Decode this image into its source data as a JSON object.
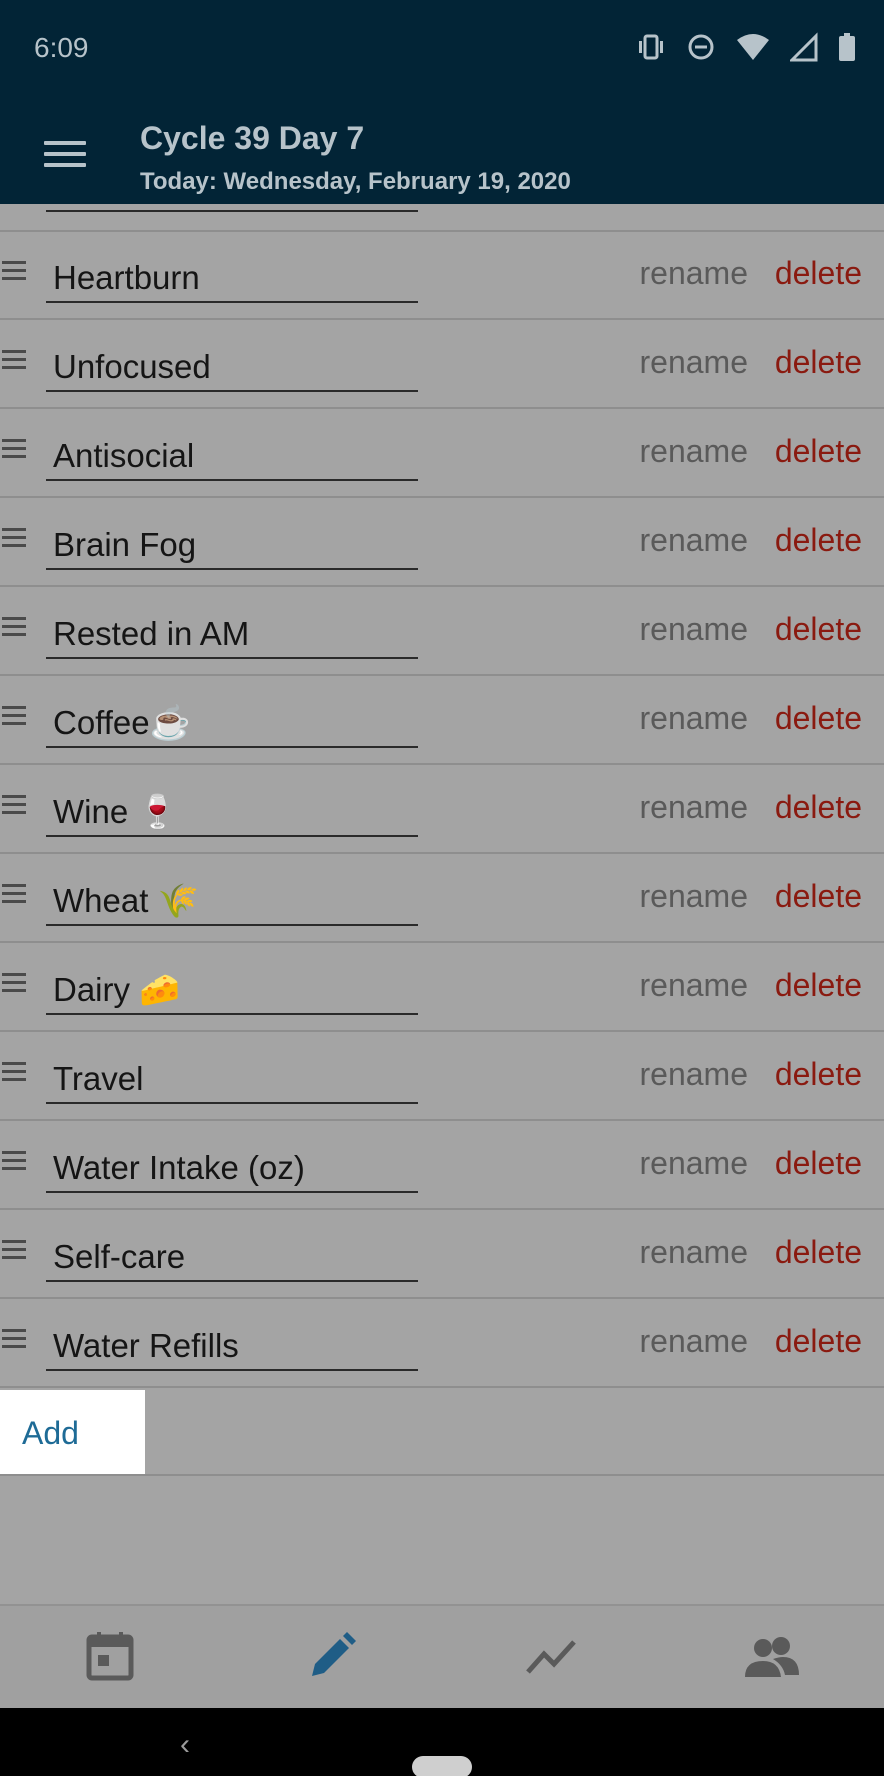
{
  "status_bar": {
    "time": "6:09",
    "icons": [
      "vibrate-icon",
      "do-not-disturb-icon",
      "wifi-icon",
      "signal-icon",
      "battery-icon"
    ]
  },
  "app_bar": {
    "title": "Cycle 39 Day 7",
    "subtitle": "Today: Wednesday, February 19, 2020",
    "menu_icon": "menu-icon"
  },
  "rows": [
    {
      "name": "Heartburn"
    },
    {
      "name": "Unfocused"
    },
    {
      "name": "Antisocial"
    },
    {
      "name": "Brain Fog"
    },
    {
      "name": "Rested in AM"
    },
    {
      "name": "Coffee☕"
    },
    {
      "name": "Wine 🍷"
    },
    {
      "name": "Wheat 🌾"
    },
    {
      "name": "Dairy 🧀"
    },
    {
      "name": "Travel"
    },
    {
      "name": "Water Intake (oz)"
    },
    {
      "name": "Self-care"
    },
    {
      "name": "Water Refills"
    }
  ],
  "row_actions": {
    "rename": "rename",
    "delete": "delete"
  },
  "add_label": "Add",
  "colors": {
    "header_bg": "#022436",
    "add_text": "#1e6b96",
    "delete_text": "#8a1a10",
    "active_tab": "#1f5d86"
  },
  "bottom_nav": [
    {
      "icon": "calendar-icon"
    },
    {
      "icon": "pencil-icon",
      "active": true
    },
    {
      "icon": "trend-chart-icon"
    },
    {
      "icon": "people-icon"
    }
  ],
  "system_nav": {
    "back_icon": "back-chevron-icon",
    "home_icon": "home-pill-icon"
  }
}
